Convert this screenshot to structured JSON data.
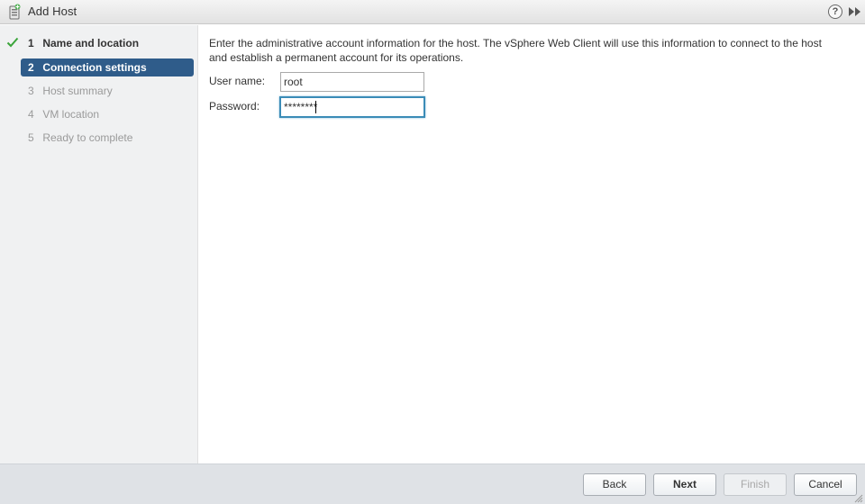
{
  "window": {
    "title": "Add Host",
    "help_label": "?",
    "icons": {
      "title": "host-add-icon",
      "help": "help-icon",
      "expand": "double-chevron-right-icon",
      "resize": "resize-grip-icon"
    }
  },
  "wizard": {
    "steps": [
      {
        "number": "1",
        "label": "Name and location",
        "state": "completed"
      },
      {
        "number": "2",
        "label": "Connection settings",
        "state": "active"
      },
      {
        "number": "3",
        "label": "Host summary",
        "state": "pending"
      },
      {
        "number": "4",
        "label": "VM location",
        "state": "pending"
      },
      {
        "number": "5",
        "label": "Ready to complete",
        "state": "pending"
      }
    ]
  },
  "content": {
    "instruction_line1": "Enter the administrative account information for the host. The vSphere Web Client will use this information to connect to the host",
    "instruction_line2": "and establish a permanent account for its operations.",
    "username": {
      "label": "User name:",
      "value": "root"
    },
    "password": {
      "label": "Password:",
      "value": "********"
    }
  },
  "footer": {
    "back_label": "Back",
    "next_label": "Next",
    "finish_label": "Finish",
    "cancel_label": "Cancel"
  },
  "colors": {
    "active_step": "#2f5c8a",
    "check": "#3aa53a",
    "focus_border": "#3b8cb7",
    "footer_bg": "#dfe2e6",
    "sidebar_bg": "#f0f1f2"
  }
}
